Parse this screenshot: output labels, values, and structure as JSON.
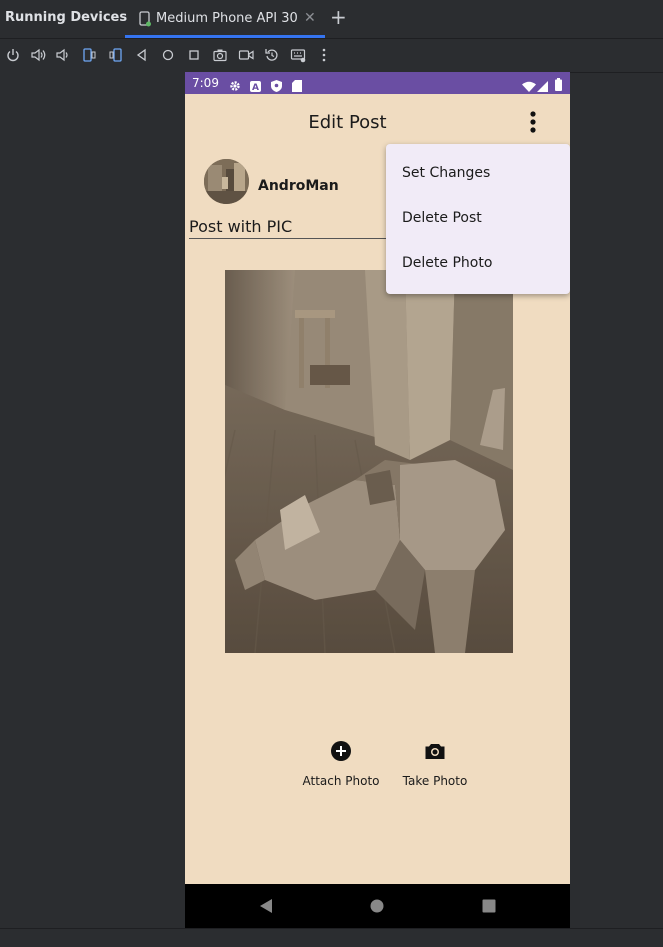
{
  "ide": {
    "panel_title": "Running Devices",
    "device_tab_label": "Medium Phone API 30",
    "toolbar_icons": [
      "power-icon",
      "volume-up-icon",
      "volume-down-icon",
      "rotate-left-icon",
      "rotate-right-icon",
      "back-icon",
      "home-icon",
      "overview-icon",
      "screenshot-icon",
      "screen-record-icon",
      "reset-icon",
      "keyboard-icon",
      "more-icon"
    ],
    "accent_color": "#3574f0"
  },
  "status_bar": {
    "time": "7:09",
    "color": "#6a4ea3",
    "icons": [
      "settings-icon",
      "a-icon",
      "shield-icon",
      "sd-card-icon",
      "wifi-icon",
      "signal-icon",
      "battery-icon"
    ]
  },
  "app_bar": {
    "title": "Edit Post"
  },
  "post": {
    "username": "AndroMan",
    "title": "Post with PIC"
  },
  "popup_menu": {
    "items": [
      "Set Changes",
      "Delete Post",
      "Delete Photo"
    ]
  },
  "actions": {
    "attach_label": "Attach Photo",
    "take_label": "Take Photo"
  },
  "theme": {
    "background": "#f0dcc1",
    "menu_background": "#f1ebf7"
  }
}
